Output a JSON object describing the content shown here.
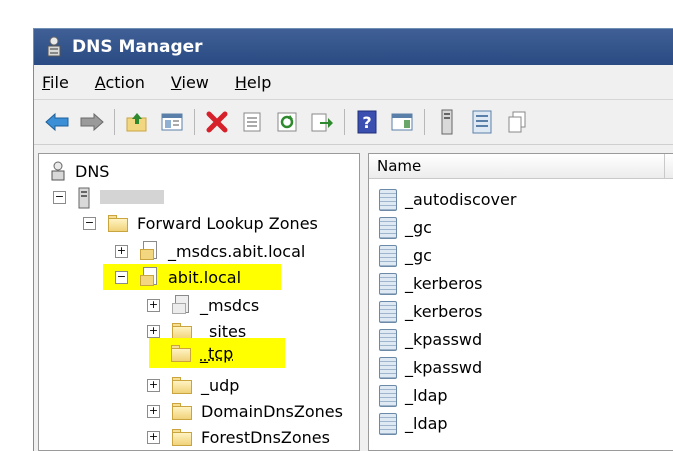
{
  "window": {
    "title": "DNS Manager"
  },
  "menu": [
    {
      "mnemonic": "F",
      "rest": "ile"
    },
    {
      "mnemonic": "A",
      "rest": "ction"
    },
    {
      "mnemonic": "V",
      "rest": "iew"
    },
    {
      "mnemonic": "H",
      "rest": "elp"
    }
  ],
  "toolbar": {
    "buttons": [
      "back-icon",
      "forward-icon",
      "up-folder-icon",
      "show-hide-tree-icon",
      "delete-icon",
      "properties-icon",
      "refresh-icon",
      "export-list-icon",
      "help-icon",
      "console-icon",
      "server-icon",
      "list-icon",
      "copy-icon"
    ]
  },
  "tree": {
    "root": "DNS",
    "server": "",
    "forward_zones": "Forward Lookup Zones",
    "msdcs_zone": "_msdcs.abit.local",
    "abit_local": "abit.local",
    "children": {
      "msdcs": "_msdcs",
      "sites": "_sites",
      "tcp": "_tcp",
      "udp": "_udp",
      "domaindns": "DomainDnsZones",
      "forestdns": "ForestDnsZones"
    }
  },
  "list": {
    "column_name": "Name",
    "items": [
      "_autodiscover",
      "_gc",
      "_gc",
      "_kerberos",
      "_kerberos",
      "_kpasswd",
      "_kpasswd",
      "_ldap",
      "_ldap"
    ]
  },
  "colors": {
    "highlight": "#ffff00",
    "titlebar": "#2f4f8a"
  }
}
